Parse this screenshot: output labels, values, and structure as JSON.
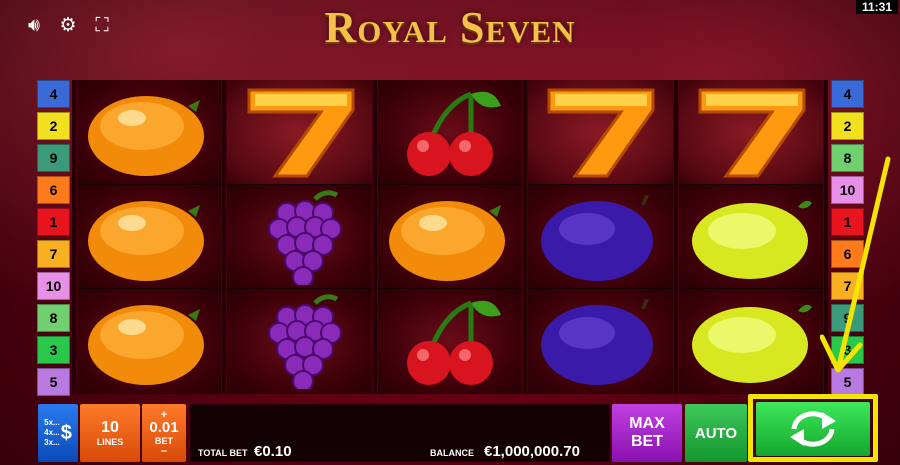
{
  "title": "Royal Seven",
  "clock": "11:31",
  "top_icons": [
    "speaker-icon",
    "gear-icon",
    "fullscreen-icon"
  ],
  "reels": [
    [
      "orange",
      "orange",
      "orange"
    ],
    [
      "seven",
      "grapes",
      "grapes"
    ],
    [
      "cherry",
      "orange",
      "cherry"
    ],
    [
      "seven",
      "plum",
      "plum"
    ],
    [
      "seven",
      "lemon",
      "lemon"
    ]
  ],
  "line_numbers_left": [
    "4",
    "2",
    "9",
    "6",
    "1",
    "7",
    "10",
    "8",
    "3",
    "5"
  ],
  "line_numbers_right": [
    "4",
    "2",
    "8",
    "10",
    "1",
    "6",
    "7",
    "9",
    "3",
    "5"
  ],
  "line_colors": {
    "1": "#e8141e",
    "2": "#f0e020",
    "3": "#2ac84a",
    "4": "#3a6ad8",
    "5": "#b87ae0",
    "6": "#ff7a1a",
    "7": "#f8b020",
    "8": "#70d070",
    "9": "#3a9a7a",
    "10": "#e890e8"
  },
  "bottom": {
    "denominations": [
      "5x...",
      "4x...",
      "3x..."
    ],
    "denom_symbol": "$",
    "lines_value": "10",
    "lines_label": "LINES",
    "bet_plus": "+",
    "bet_value": "0.01",
    "bet_label": "BET",
    "bet_minus": "–",
    "total_bet_label": "TOTAL BET",
    "total_bet_value": "€0.10",
    "balance_label": "BALANCE",
    "balance_value": "€1,000,000.70",
    "max_bet_line1": "MAX",
    "max_bet_line2": "BET",
    "auto_label": "AUTO"
  },
  "colors": {
    "accent_highlight": "#f4e400",
    "spin_button": "#22b83a",
    "max_bet": "#a628c8",
    "lines_bet": "#f06010",
    "denom": "#1a60d0"
  }
}
